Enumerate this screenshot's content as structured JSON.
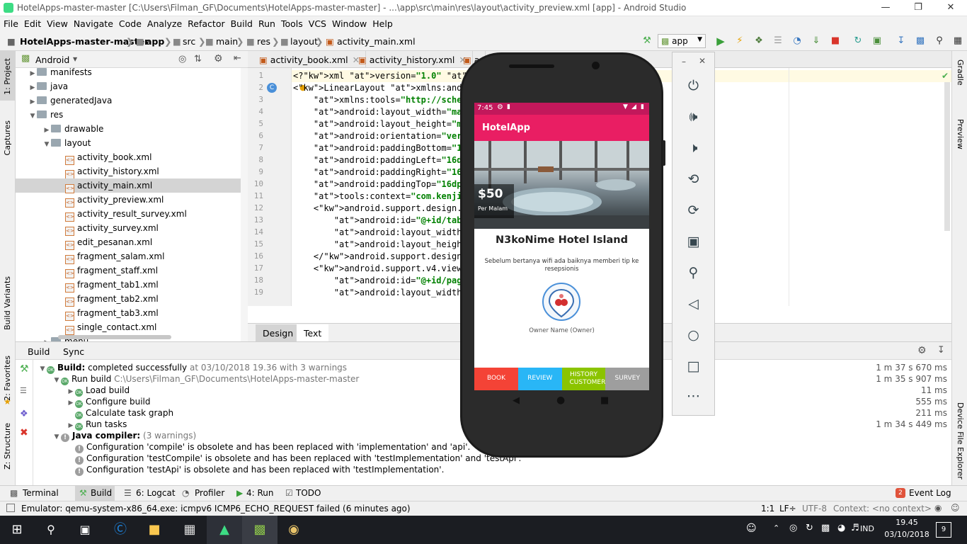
{
  "window": {
    "title": "HotelApps-master-master [C:\\Users\\Filman_GF\\Documents\\HotelApps-master-master] - ...\\app\\src\\main\\res\\layout\\activity_preview.xml [app] - Android Studio"
  },
  "menu": [
    "File",
    "Edit",
    "View",
    "Navigate",
    "Code",
    "Analyze",
    "Refactor",
    "Build",
    "Run",
    "Tools",
    "VCS",
    "Window",
    "Help"
  ],
  "breadcrumb": [
    "HotelApps-master-master",
    "app",
    "src",
    "main",
    "res",
    "layout",
    "activity_main.xml"
  ],
  "toolbar": {
    "run_config": "app"
  },
  "project": {
    "view_mode": "Android",
    "tree": [
      {
        "label": "manifests",
        "type": "folder",
        "indent": 1,
        "arrow": "right"
      },
      {
        "label": "java",
        "type": "folder",
        "indent": 1,
        "arrow": "right"
      },
      {
        "label": "generatedJava",
        "type": "folder",
        "indent": 1,
        "arrow": "right"
      },
      {
        "label": "res",
        "type": "folder",
        "indent": 1,
        "arrow": "down"
      },
      {
        "label": "drawable",
        "type": "folder",
        "indent": 2,
        "arrow": "right"
      },
      {
        "label": "layout",
        "type": "folder",
        "indent": 2,
        "arrow": "down"
      },
      {
        "label": "activity_book.xml",
        "type": "xml",
        "indent": 3
      },
      {
        "label": "activity_history.xml",
        "type": "xml",
        "indent": 3
      },
      {
        "label": "activity_main.xml",
        "type": "xml",
        "indent": 3,
        "selected": true
      },
      {
        "label": "activity_preview.xml",
        "type": "xml",
        "indent": 3
      },
      {
        "label": "activity_result_survey.xml",
        "type": "xml",
        "indent": 3
      },
      {
        "label": "activity_survey.xml",
        "type": "xml",
        "indent": 3
      },
      {
        "label": "edit_pesanan.xml",
        "type": "xml",
        "indent": 3
      },
      {
        "label": "fragment_salam.xml",
        "type": "xml",
        "indent": 3
      },
      {
        "label": "fragment_staff.xml",
        "type": "xml",
        "indent": 3
      },
      {
        "label": "fragment_tab1.xml",
        "type": "xml",
        "indent": 3
      },
      {
        "label": "fragment_tab2.xml",
        "type": "xml",
        "indent": 3
      },
      {
        "label": "fragment_tab3.xml",
        "type": "xml",
        "indent": 3
      },
      {
        "label": "single_contact.xml",
        "type": "xml",
        "indent": 3
      },
      {
        "label": "menu",
        "type": "folder",
        "indent": 2,
        "arrow": "right"
      }
    ]
  },
  "left_strip": [
    "1: Project",
    "Captures",
    "Build Variants",
    "2: Favorites",
    "Z: Structure"
  ],
  "right_strip": [
    "Gradle",
    "Preview",
    "Device File Explorer"
  ],
  "editor": {
    "tabs": [
      "activity_book.xml",
      "activity_history.xml",
      "a"
    ],
    "lines": [
      {
        "n": "1",
        "text": "<?xml version=\"1.0\" encoding=\"utf-"
      },
      {
        "n": "2",
        "text": "<LinearLayout xmlns:android=\"http:"
      },
      {
        "n": "3",
        "text": "    xmlns:tools=\"http://schemas.an"
      },
      {
        "n": "4",
        "text": "    android:layout_width=\"match_pa"
      },
      {
        "n": "5",
        "text": "    android:layout_height=\"match_p"
      },
      {
        "n": "6",
        "text": "    android:orientation=\"vertical\""
      },
      {
        "n": "7",
        "text": "    android:paddingBottom=\"16dp\""
      },
      {
        "n": "8",
        "text": "    android:paddingLeft=\"16dp\""
      },
      {
        "n": "9",
        "text": "    android:paddingRight=\"16dp\""
      },
      {
        "n": "10",
        "text": "    android:paddingTop=\"16dp\""
      },
      {
        "n": "11",
        "text": "    tools:context=\"com.kenjin.hote"
      },
      {
        "n": "12",
        "text": "    <android.support.design.widge"
      },
      {
        "n": "13",
        "text": "        android:id=\"@+id/tabs\""
      },
      {
        "n": "14",
        "text": "        android:layout_width=\"matc"
      },
      {
        "n": "15",
        "text": "        android:layout_height=\"wra"
      },
      {
        "n": "16",
        "text": "    </android.support.design.widge"
      },
      {
        "n": "17",
        "text": "    <android.support.v4.view.ViewP"
      },
      {
        "n": "18",
        "text": "        android:id=\"@+id/pager\""
      },
      {
        "n": "19",
        "text": "        android:layout_width=\"matc"
      }
    ],
    "bottom_tabs": [
      "Design",
      "Text"
    ]
  },
  "build": {
    "tabs": [
      "Build",
      "Sync"
    ],
    "rows": [
      {
        "icon": "ok",
        "bold": "Build:",
        "text": "completed successfully",
        "gray": "at 03/10/2018 19.36   with 3 warnings",
        "time": "1 m 37 s 670 ms",
        "indent": 0,
        "arrow": "down"
      },
      {
        "icon": "ok",
        "text": "Run build",
        "gray": "C:\\Users\\Filman_GF\\Documents\\HotelApps-master-master",
        "time": "1 m 35 s 907 ms",
        "indent": 1,
        "arrow": "down"
      },
      {
        "icon": "ok",
        "text": "Load build",
        "time": "11 ms",
        "indent": 2,
        "arrow": "right"
      },
      {
        "icon": "ok",
        "text": "Configure build",
        "time": "555 ms",
        "indent": 2,
        "arrow": "right"
      },
      {
        "icon": "ok",
        "text": "Calculate task graph",
        "time": "211 ms",
        "indent": 2,
        "arrow": ""
      },
      {
        "icon": "ok",
        "text": "Run tasks",
        "time": "1 m 34 s 449 ms",
        "indent": 2,
        "arrow": "right"
      },
      {
        "icon": "warn",
        "bold": "Java compiler:",
        "gray": "(3 warnings)",
        "indent": 1,
        "arrow": "down"
      },
      {
        "icon": "warn",
        "text": "Configuration 'compile' is obsolete and has been replaced with 'implementation' and 'api'.",
        "indent": 2,
        "arrow": ""
      },
      {
        "icon": "warn",
        "text": "Configuration 'testCompile' is obsolete and has been replaced with 'testImplementation' and 'testApi'.",
        "indent": 2,
        "arrow": ""
      },
      {
        "icon": "warn",
        "text": "Configuration 'testApi' is obsolete and has been replaced with 'testImplementation'.",
        "indent": 2,
        "arrow": ""
      }
    ]
  },
  "bottom_tools": [
    "Terminal",
    "Build",
    "6: Logcat",
    "Profiler",
    "4: Run",
    "TODO"
  ],
  "event_log": {
    "label": "Event Log",
    "badge": "2"
  },
  "status": {
    "message": "Emulator: qemu-system-x86_64.exe: icmpv6 ICMP6_ECHO_REQUEST failed (6 minutes ago)",
    "position": "1:1",
    "line_sep": "LF÷",
    "encoding": "UTF-8",
    "context": "Context: <no context>"
  },
  "phone": {
    "time": "7:45",
    "app_title": "HotelApp",
    "price": "$50",
    "price_unit": "Per Malam",
    "hotel_name": "N3koNime Hotel Island",
    "tagline": "Sebelum bertanya wifi ada baiknya memberi tip ke resepsionis",
    "owner": "Owner Name (Owner)",
    "nav": [
      {
        "label": "BOOK",
        "color": "#f44336"
      },
      {
        "label": "REVIEW",
        "color": "#29b6f6"
      },
      {
        "label": "HISTORY CUSTOMER",
        "color": "#8bc400"
      },
      {
        "label": "SURVEY",
        "color": "#9e9e9e"
      }
    ]
  },
  "taskbar": {
    "lang": "IND",
    "time": "19.45",
    "date": "03/10/2018",
    "notif_count": "9"
  }
}
